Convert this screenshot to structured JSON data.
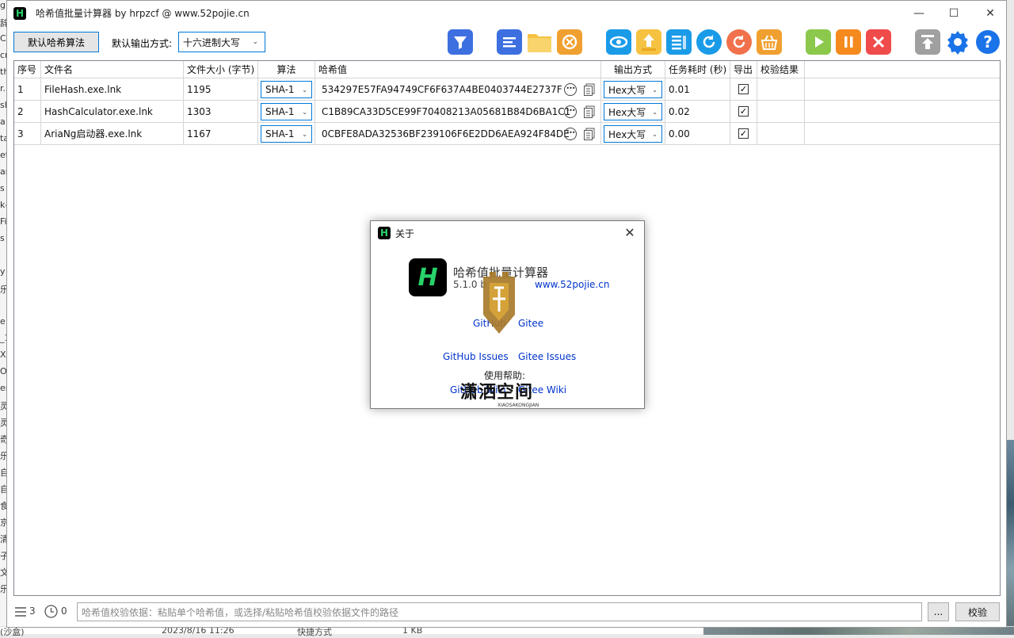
{
  "background": {
    "left_fragments": [
      "g",
      "辞",
      "C",
      "cr",
      "th",
      "r.",
      "sh",
      "a",
      "ta",
      "et",
      "an",
      "s",
      "k-",
      "Fi",
      "s",
      "",
      "y",
      "乐",
      "",
      "e",
      "_1",
      "XI",
      "O",
      "er",
      "灵",
      "灵",
      "奇",
      "乐",
      "自",
      "自",
      "食",
      "京",
      "清",
      "子",
      "文",
      "乐"
    ],
    "bottom_fragments": [
      "(沙盒)",
      "2023/8/16 11:26",
      "快捷方式",
      "1 KB"
    ]
  },
  "window": {
    "title": "哈希值批量计算器 by hrpzcf @ www.52pojie.cn",
    "controls": {
      "minimize": "—",
      "maximize": "☐",
      "close": "✕"
    }
  },
  "toolbar": {
    "default_algo_button": "默认哈希算法",
    "output_label": "默认输出方式:",
    "output_value": "十六进制大写",
    "icons": [
      {
        "name": "filter-icon",
        "color": "#3d6fe0"
      },
      {
        "name": "list-icon",
        "color": "#3d6fe0"
      },
      {
        "name": "folder-icon",
        "color": "#f5c242"
      },
      {
        "name": "clear-icon",
        "color": "#f0a030"
      },
      {
        "name": "eye-icon",
        "color": "#1a9be8"
      },
      {
        "name": "export-icon",
        "color": "#f5c242"
      },
      {
        "name": "details-icon",
        "color": "#1a9be8"
      },
      {
        "name": "refresh-icon",
        "color": "#1a9be8"
      },
      {
        "name": "redo-icon",
        "color": "#f0714b"
      },
      {
        "name": "basket-icon",
        "color": "#f0a030"
      },
      {
        "name": "start-icon",
        "color": "#8cc84b"
      },
      {
        "name": "pause-icon",
        "color": "#f58a1f"
      },
      {
        "name": "stop-icon",
        "color": "#f04b4b"
      },
      {
        "name": "top-icon",
        "color": "#a0a0a0"
      },
      {
        "name": "settings-icon",
        "color": "#1a73e8"
      },
      {
        "name": "help-icon",
        "color": "#1a73e8"
      }
    ]
  },
  "table": {
    "headers": [
      "序号",
      "文件名",
      "文件大小 (字节)",
      "算法",
      "哈希值",
      "输出方式",
      "任务耗时 (秒)",
      "导出",
      "校验结果"
    ],
    "rows": [
      {
        "index": "1",
        "file": "FileHash.exe.lnk",
        "size": "1195",
        "algo": "SHA-1",
        "hash": "534297E57FA94749CF6F637A4BE0403744E2737F",
        "output": "Hex大写",
        "time": "0.01",
        "export": "✓",
        "check": ""
      },
      {
        "index": "2",
        "file": "HashCalculator.exe.lnk",
        "size": "1303",
        "algo": "SHA-1",
        "hash": "C1B89CA33D5CE99F70408213A05681B84D6BA1C1",
        "output": "Hex大写",
        "time": "0.02",
        "export": "✓",
        "check": ""
      },
      {
        "index": "3",
        "file": "AriaNg启动器.exe.lnk",
        "size": "1167",
        "algo": "SHA-1",
        "hash": "0CBFE8ADA32536BF239106F6E2DD6AEA924F84DE",
        "output": "Hex大写",
        "time": "0.00",
        "export": "✓",
        "check": ""
      }
    ]
  },
  "statusbar": {
    "count": "3",
    "timer": "0",
    "path_placeholder": "哈希值校验依据：粘贴单个哈希值，或选择/粘贴哈希值校验依据文件的路径",
    "browse_button": "...",
    "verify_button": "校验"
  },
  "about": {
    "title": "关于",
    "app_name": "哈希值批量计算器",
    "version_prefix": "5.1.0 b",
    "site": "www.52pojie.cn",
    "github": "GitHub",
    "gitee": "Gitee",
    "github_issues": "GitHub Issues",
    "gitee_issues": "Gitee Issues",
    "help_label": "使用帮助:",
    "github_wiki": "GitHub Wiki",
    "gitee_wiki": "Gitee Wiki",
    "watermark_text": "潇洒空间",
    "watermark_sub": "XIAOSAKONGJIAN"
  }
}
